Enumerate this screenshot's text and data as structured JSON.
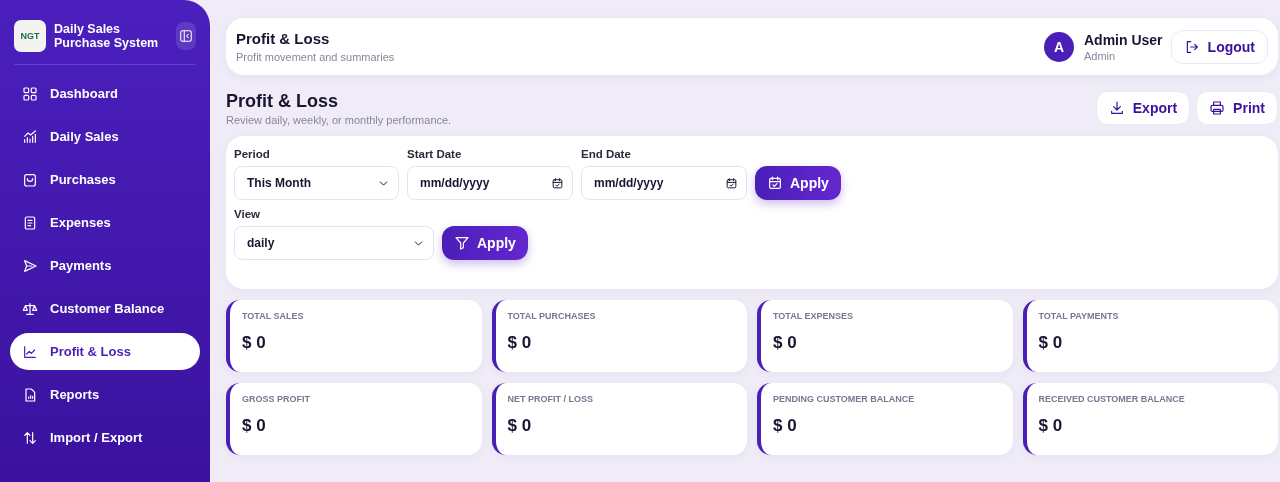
{
  "sidebar": {
    "logo_text": "NGT",
    "app_name": "Daily Sales Purchase System",
    "items": [
      {
        "label": "Dashboard",
        "selected": false
      },
      {
        "label": "Daily Sales",
        "selected": false
      },
      {
        "label": "Purchases",
        "selected": false
      },
      {
        "label": "Expenses",
        "selected": false
      },
      {
        "label": "Payments",
        "selected": false
      },
      {
        "label": "Customer Balance",
        "selected": false
      },
      {
        "label": "Profit & Loss",
        "selected": true
      },
      {
        "label": "Reports",
        "selected": false
      },
      {
        "label": "Import / Export",
        "selected": false
      }
    ]
  },
  "header": {
    "title": "Profit & Loss",
    "subtitle": "Profit movement and summaries",
    "avatar_letter": "A",
    "user_name": "Admin User",
    "user_role": "Admin",
    "logout": "Logout"
  },
  "page": {
    "title": "Profit & Loss",
    "subtitle": "Review daily, weekly, or monthly performance.",
    "actions": [
      {
        "label": "Export"
      },
      {
        "label": "Print"
      }
    ]
  },
  "filters": {
    "period": {
      "label": "Period",
      "value": "This Month"
    },
    "start_date": {
      "label": "Start Date",
      "placeholder": "mm/dd/yyyy"
    },
    "end_date": {
      "label": "End Date",
      "placeholder": "mm/dd/yyyy"
    },
    "apply_dates": "Apply",
    "view": {
      "label": "View",
      "value": "daily"
    },
    "apply_view": "Apply"
  },
  "stats": [
    {
      "label": "TOTAL SALES",
      "value": "$ 0"
    },
    {
      "label": "TOTAL PURCHASES",
      "value": "$ 0"
    },
    {
      "label": "TOTAL EXPENSES",
      "value": "$ 0"
    },
    {
      "label": "TOTAL PAYMENTS",
      "value": "$ 0"
    },
    {
      "label": "GROSS PROFIT",
      "value": "$ 0"
    },
    {
      "label": "NET PROFIT / LOSS",
      "value": "$ 0"
    },
    {
      "label": "PENDING CUSTOMER BALANCE",
      "value": "$ 0"
    },
    {
      "label": "RECEIVED CUSTOMER BALANCE",
      "value": "$ 0"
    }
  ]
}
